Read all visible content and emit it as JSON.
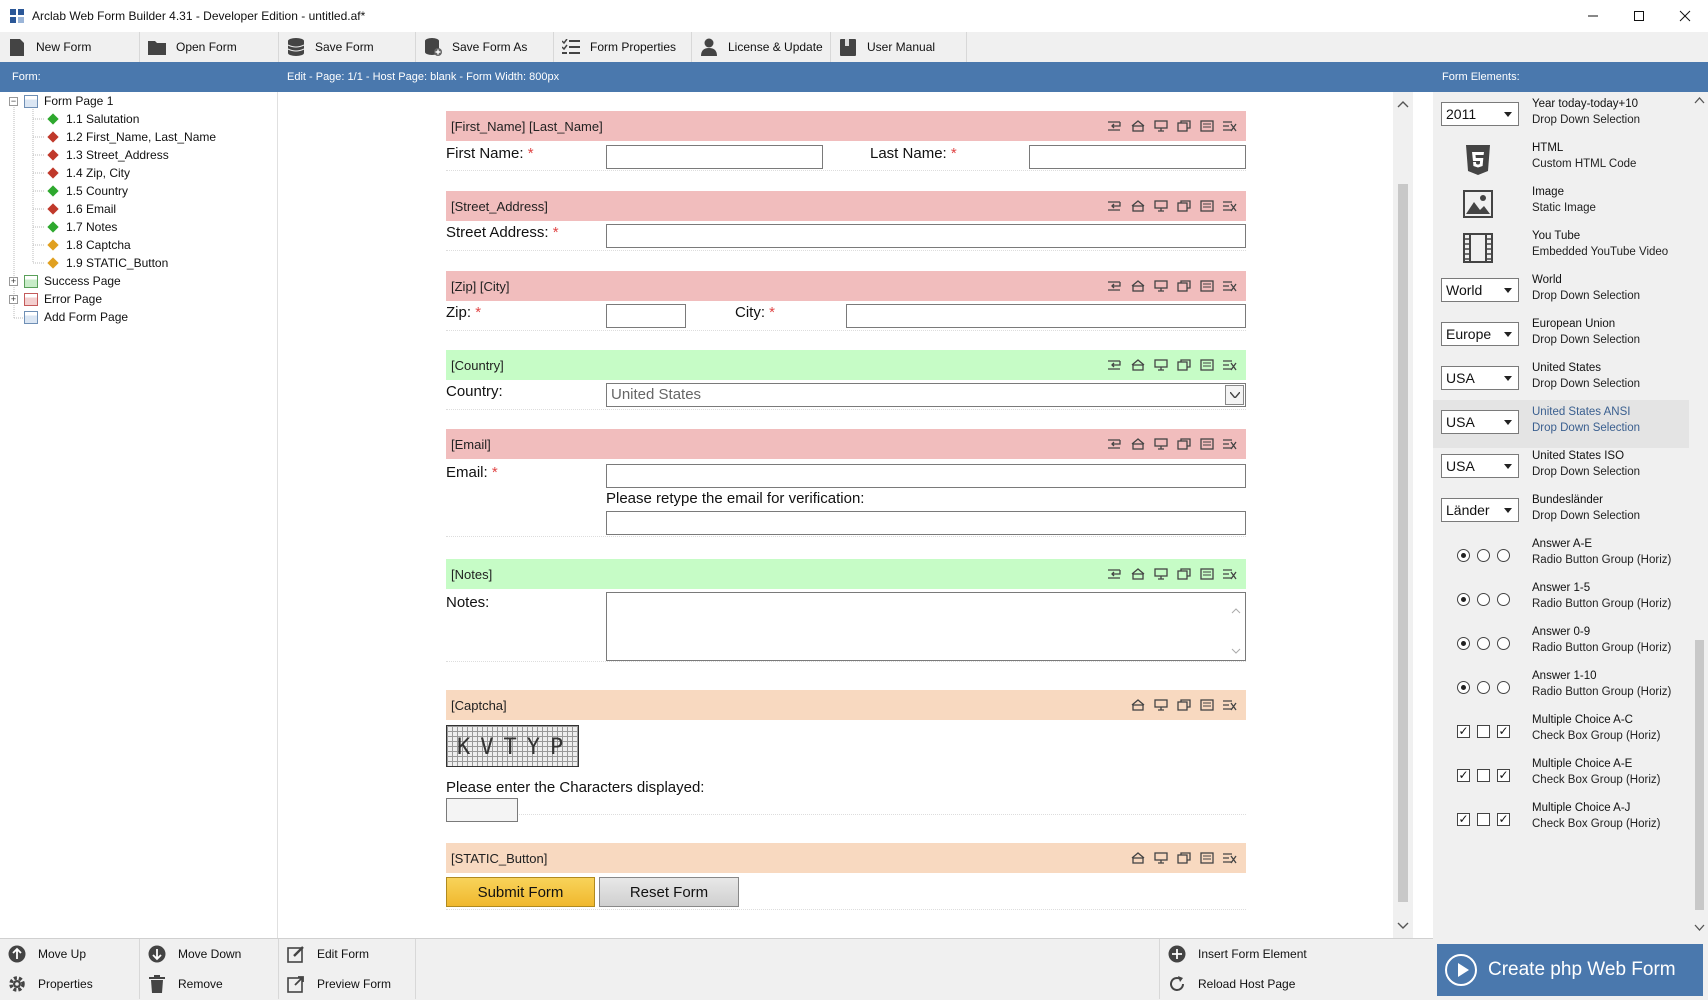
{
  "window": {
    "title": "Arclab Web Form Builder 4.31 - Developer Edition - untitled.af*"
  },
  "toolbar": {
    "new_form": "New Form",
    "open_form": "Open Form",
    "save_form": "Save Form",
    "save_form_as": "Save Form As",
    "form_properties": "Form Properties",
    "license_update": "License & Update",
    "user_manual": "User Manual"
  },
  "header": {
    "form_label": "Form:",
    "edit_info": "Edit - Page: 1/1 - Host Page: blank - Form Width: 800px",
    "elements_label": "Form Elements:"
  },
  "tree": {
    "form_page": "Form Page 1",
    "items": [
      {
        "label": "1.1 Salutation",
        "color": "#2ea82e"
      },
      {
        "label": "1.2 First_Name, Last_Name",
        "color": "#c0392b"
      },
      {
        "label": "1.3 Street_Address",
        "color": "#c0392b"
      },
      {
        "label": "1.4 Zip, City",
        "color": "#c0392b"
      },
      {
        "label": "1.5 Country",
        "color": "#2ea82e"
      },
      {
        "label": "1.6 Email",
        "color": "#c0392b"
      },
      {
        "label": "1.7 Notes",
        "color": "#2ea82e"
      },
      {
        "label": "1.8 Captcha",
        "color": "#e0a020"
      },
      {
        "label": "1.9 STATIC_Button",
        "color": "#e0a020"
      }
    ],
    "success_page": "Success Page",
    "error_page": "Error Page",
    "add_page": "Add Form Page"
  },
  "form": {
    "name_block": {
      "header": "[First_Name] [Last_Name]",
      "first_label": "First Name:",
      "last_label": "Last Name:"
    },
    "street_block": {
      "header": "[Street_Address]",
      "label": "Street Address:"
    },
    "zip_block": {
      "header": "[Zip] [City]",
      "zip_label": "Zip:",
      "city_label": "City:"
    },
    "country_block": {
      "header": "[Country]",
      "label": "Country:",
      "value": "United States"
    },
    "email_block": {
      "header": "[Email]",
      "label": "Email:",
      "verify_label": "Please retype the email for verification:"
    },
    "notes_block": {
      "header": "[Notes]",
      "label": "Notes:"
    },
    "captcha_block": {
      "header": "[Captcha]",
      "captcha_text": "KVTYP",
      "prompt": "Please enter the Characters displayed:"
    },
    "button_block": {
      "header": "[STATIC_Button]",
      "submit": "Submit Form",
      "reset": "Reset Form"
    },
    "required_mark": "*"
  },
  "elements": [
    {
      "kind": "dropdown",
      "value": "2011",
      "title": "Year today-today+10",
      "sub": "Drop Down Selection"
    },
    {
      "kind": "icon",
      "icon": "html5-icon",
      "title": "HTML",
      "sub": "Custom HTML Code"
    },
    {
      "kind": "icon",
      "icon": "image-icon",
      "title": "Image",
      "sub": "Static Image"
    },
    {
      "kind": "icon",
      "icon": "film-icon",
      "title": "You Tube",
      "sub": "Embedded YouTube Video"
    },
    {
      "kind": "dropdown",
      "value": "World",
      "title": "World",
      "sub": "Drop Down Selection"
    },
    {
      "kind": "dropdown",
      "value": "Europe",
      "title": "European Union",
      "sub": "Drop Down Selection"
    },
    {
      "kind": "dropdown",
      "value": "USA",
      "title": "United States",
      "sub": "Drop Down Selection"
    },
    {
      "kind": "dropdown",
      "value": "USA",
      "title": "United States ANSI",
      "sub": "Drop Down Selection",
      "highlight": true
    },
    {
      "kind": "dropdown",
      "value": "USA",
      "title": "United States ISO",
      "sub": "Drop Down Selection"
    },
    {
      "kind": "dropdown",
      "value": "Länder",
      "title": "Bundesländer",
      "sub": "Drop Down Selection"
    },
    {
      "kind": "radio",
      "title": "Answer A-E",
      "sub": "Radio Button Group (Horiz)"
    },
    {
      "kind": "radio",
      "title": "Answer 1-5",
      "sub": "Radio Button Group (Horiz)"
    },
    {
      "kind": "radio",
      "title": "Answer 0-9",
      "sub": "Radio Button Group (Horiz)"
    },
    {
      "kind": "radio",
      "title": "Answer 1-10",
      "sub": "Radio Button Group (Horiz)"
    },
    {
      "kind": "check",
      "title": "Multiple Choice A-C",
      "sub": "Check Box Group (Horiz)"
    },
    {
      "kind": "check",
      "title": "Multiple Choice A-E",
      "sub": "Check Box Group (Horiz)"
    },
    {
      "kind": "check",
      "title": "Multiple Choice A-J",
      "sub": "Check Box Group (Horiz)"
    }
  ],
  "bottom": {
    "move_up": "Move Up",
    "move_down": "Move Down",
    "edit_form": "Edit Form",
    "properties": "Properties",
    "remove": "Remove",
    "preview_form": "Preview Form",
    "insert_element": "Insert Form Element",
    "reload_host": "Reload Host Page",
    "create": "Create php Web Form"
  },
  "colors": {
    "accent_blue": "#4a78ad",
    "required_header": "#f1bdbd",
    "optional_header": "#c6fcc6",
    "static_header": "#f8d9c0"
  }
}
